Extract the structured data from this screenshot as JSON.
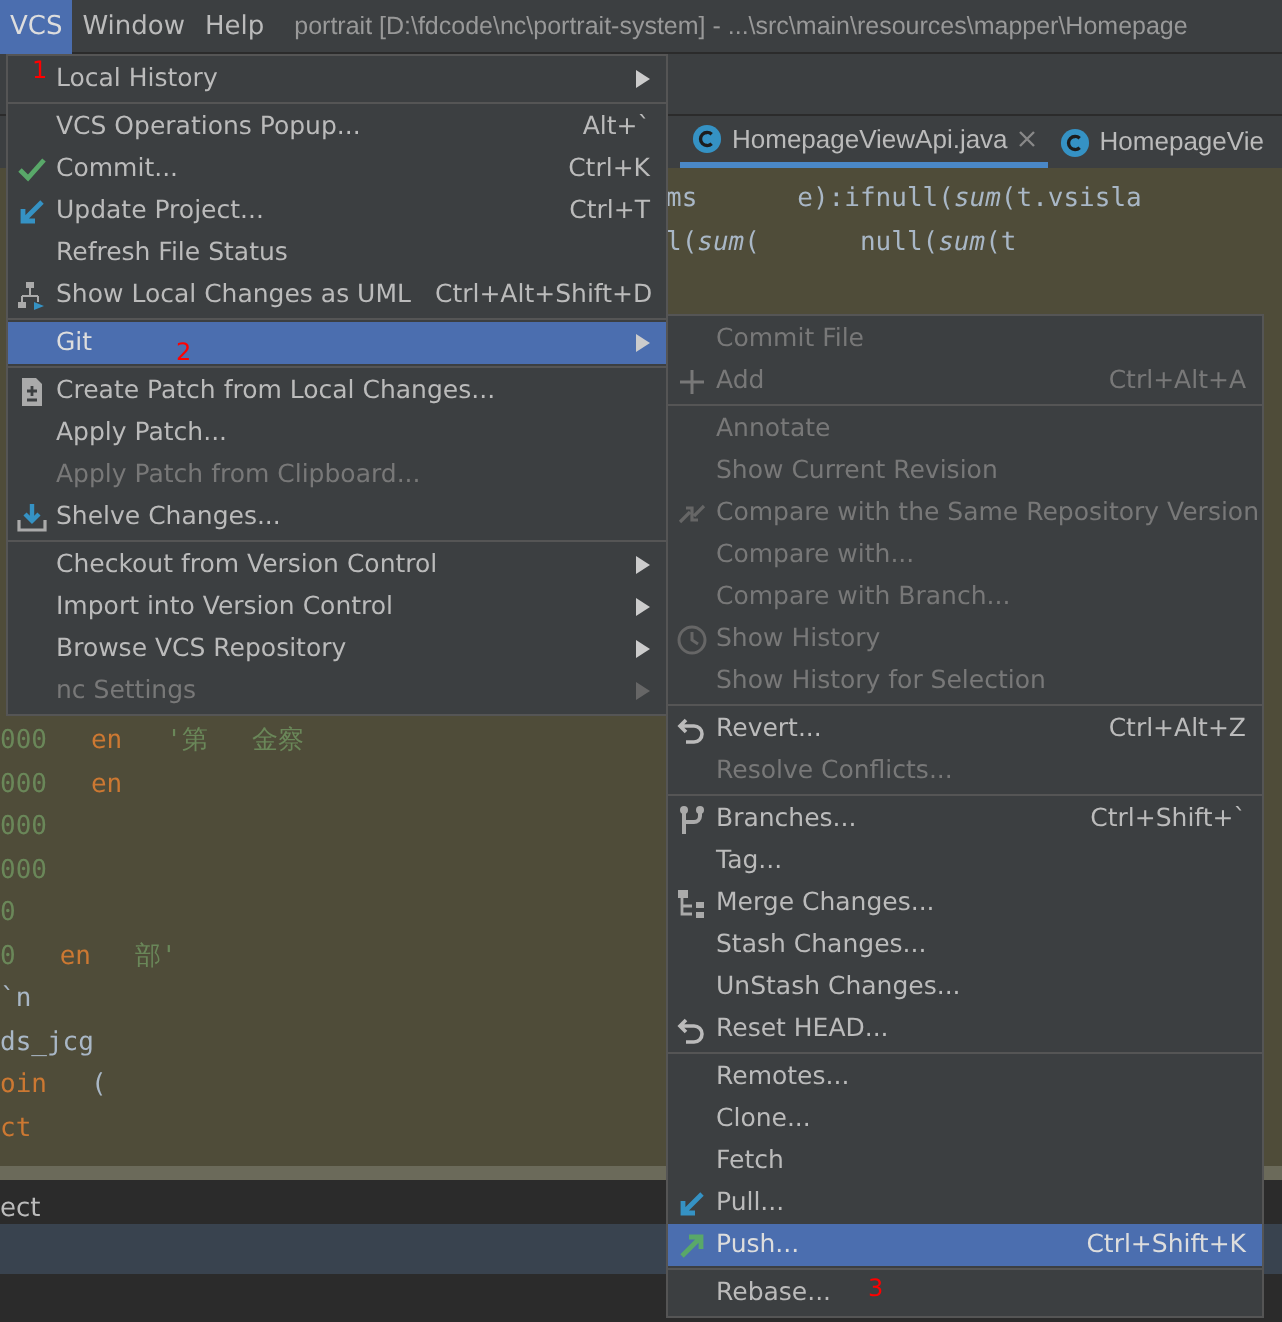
{
  "menubar": [
    {
      "label": "VCS",
      "selected": true
    },
    {
      "label": "Window",
      "selected": false
    },
    {
      "label": "Help",
      "selected": false
    }
  ],
  "window": {
    "title": "portrait [D:\\fdcode\\nc\\portrait-system] - ...\\src\\main\\resources\\mapper\\Homepage"
  },
  "tabs": [
    {
      "label": "HomepageViewApi.java",
      "selected": true
    },
    {
      "label": "HomepageVie",
      "selected": false
    }
  ],
  "editor_top_lines": [
    [
      "ms",
      "e):ifnull(*sum*(t.vsisla"
    ],
    [
      "l(*sum*(",
      "null(*sum*(t"
    ]
  ],
  "editor_lines": [
    [
      {
        "kind": "num",
        "text": "000"
      },
      {
        "kind": "kw",
        "text": "en"
      },
      {
        "kind": "str",
        "text": "'第"
      },
      {
        "kind": "str",
        "text": "金察"
      }
    ],
    [
      {
        "kind": "num",
        "text": "000"
      },
      {
        "kind": "kw",
        "text": "en"
      }
    ],
    [
      {
        "kind": "num",
        "text": "000"
      }
    ],
    [
      {
        "kind": "num",
        "text": "000"
      }
    ],
    [
      {
        "kind": "num",
        "text": "0"
      }
    ],
    [
      {
        "kind": "num",
        "text": "0"
      },
      {
        "kind": "kw",
        "text": "en"
      },
      {
        "kind": "str",
        "text": "部'"
      }
    ],
    [
      {
        "kind": "plain",
        "text": "`n"
      }
    ],
    [
      {
        "kind": "plain",
        "text": "ds_jcg"
      }
    ],
    [
      {
        "kind": "kw",
        "text": "oin"
      },
      {
        "kind": "plain",
        "text": "("
      }
    ],
    [
      {
        "kind": "kw",
        "text": "ct"
      }
    ]
  ],
  "bottom_panel": {
    "text": "ect"
  },
  "vcs_menu": [
    {
      "kind": "item",
      "label": "Local History",
      "submenu": true,
      "disabled": false,
      "selected": false
    },
    {
      "kind": "separator"
    },
    {
      "kind": "item",
      "label": "VCS Operations Popup...",
      "shortcut": "Alt+`",
      "disabled": false,
      "selected": false
    },
    {
      "kind": "item",
      "label": "Commit...",
      "shortcut": "Ctrl+K",
      "disabled": false,
      "selected": false
    },
    {
      "kind": "item",
      "label": "Update Project...",
      "shortcut": "Ctrl+T",
      "disabled": false,
      "selected": false
    },
    {
      "kind": "item",
      "label": "Refresh File Status",
      "disabled": false,
      "selected": false
    },
    {
      "kind": "item",
      "label": "Show Local Changes as UML",
      "shortcut": "Ctrl+Alt+Shift+D",
      "disabled": false,
      "selected": false
    },
    {
      "kind": "separator"
    },
    {
      "kind": "item",
      "label": "Git",
      "submenu": true,
      "disabled": false,
      "selected": true
    },
    {
      "kind": "separator"
    },
    {
      "kind": "item",
      "label": "Create Patch from Local Changes...",
      "disabled": false,
      "selected": false
    },
    {
      "kind": "item",
      "label": "Apply Patch...",
      "disabled": false,
      "selected": false
    },
    {
      "kind": "item",
      "label": "Apply Patch from Clipboard...",
      "disabled": true,
      "selected": false
    },
    {
      "kind": "item",
      "label": "Shelve Changes...",
      "disabled": false,
      "selected": false
    },
    {
      "kind": "separator"
    },
    {
      "kind": "item",
      "label": "Checkout from Version Control",
      "submenu": true,
      "disabled": false,
      "selected": false
    },
    {
      "kind": "item",
      "label": "Import into Version Control",
      "submenu": true,
      "disabled": false,
      "selected": false
    },
    {
      "kind": "item",
      "label": "Browse VCS Repository",
      "submenu": true,
      "disabled": false,
      "selected": false
    },
    {
      "kind": "item",
      "label": "nc Settings",
      "submenu": true,
      "disabled": true,
      "selected": false
    }
  ],
  "git_menu": [
    {
      "kind": "item",
      "label": "Commit File",
      "disabled": true,
      "selected": false
    },
    {
      "kind": "item",
      "label": "Add",
      "shortcut": "Ctrl+Alt+A",
      "disabled": true,
      "selected": false
    },
    {
      "kind": "separator"
    },
    {
      "kind": "item",
      "label": "Annotate",
      "disabled": true,
      "selected": false
    },
    {
      "kind": "item",
      "label": "Show Current Revision",
      "disabled": true,
      "selected": false
    },
    {
      "kind": "item",
      "label": "Compare with the Same Repository Version",
      "disabled": true,
      "selected": false
    },
    {
      "kind": "item",
      "label": "Compare with...",
      "disabled": true,
      "selected": false
    },
    {
      "kind": "item",
      "label": "Compare with Branch...",
      "disabled": true,
      "selected": false
    },
    {
      "kind": "item",
      "label": "Show History",
      "disabled": true,
      "selected": false
    },
    {
      "kind": "item",
      "label": "Show History for Selection",
      "disabled": true,
      "selected": false
    },
    {
      "kind": "separator"
    },
    {
      "kind": "item",
      "label": "Revert...",
      "shortcut": "Ctrl+Alt+Z",
      "disabled": false,
      "selected": false
    },
    {
      "kind": "item",
      "label": "Resolve Conflicts...",
      "disabled": true,
      "selected": false
    },
    {
      "kind": "separator"
    },
    {
      "kind": "item",
      "label": "Branches...",
      "shortcut": "Ctrl+Shift+`",
      "disabled": false,
      "selected": false
    },
    {
      "kind": "item",
      "label": "Tag...",
      "disabled": false,
      "selected": false
    },
    {
      "kind": "item",
      "label": "Merge Changes...",
      "disabled": false,
      "selected": false
    },
    {
      "kind": "item",
      "label": "Stash Changes...",
      "disabled": false,
      "selected": false
    },
    {
      "kind": "item",
      "label": "UnStash Changes...",
      "disabled": false,
      "selected": false
    },
    {
      "kind": "item",
      "label": "Reset HEAD...",
      "disabled": false,
      "selected": false
    },
    {
      "kind": "separator"
    },
    {
      "kind": "item",
      "label": "Remotes...",
      "disabled": false,
      "selected": false
    },
    {
      "kind": "item",
      "label": "Clone...",
      "disabled": false,
      "selected": false
    },
    {
      "kind": "item",
      "label": "Fetch",
      "disabled": false,
      "selected": false
    },
    {
      "kind": "item",
      "label": "Pull...",
      "disabled": false,
      "selected": false
    },
    {
      "kind": "item",
      "label": "Push...",
      "shortcut": "Ctrl+Shift+K",
      "disabled": false,
      "selected": true
    },
    {
      "kind": "separator"
    },
    {
      "kind": "item",
      "label": "Rebase...",
      "disabled": false,
      "selected": false
    }
  ],
  "annotations": [
    "1",
    "2",
    "3"
  ]
}
